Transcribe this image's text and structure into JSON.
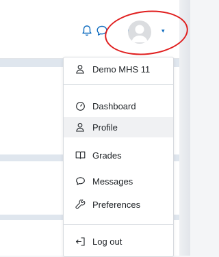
{
  "topbar": {
    "icons": [
      "globe-icon",
      "notification-bell-icon",
      "messages-bubble-icon"
    ],
    "user_menu_caret": "▾"
  },
  "annotation": {
    "ring_color": "#e01e1e"
  },
  "user_menu": {
    "user_name": "Demo MHS 11",
    "items": [
      {
        "label": "Dashboard",
        "icon": "dashboard-gauge-icon"
      },
      {
        "label": "Profile",
        "icon": "profile-person-icon"
      },
      {
        "label": "Grades",
        "icon": "grades-book-icon"
      },
      {
        "label": "Messages",
        "icon": "messages-bubble-icon"
      },
      {
        "label": "Preferences",
        "icon": "preferences-wrench-icon"
      }
    ],
    "logout_label": "Log out"
  },
  "colors": {
    "accent": "#0f6cbf",
    "text": "#1d2125"
  }
}
